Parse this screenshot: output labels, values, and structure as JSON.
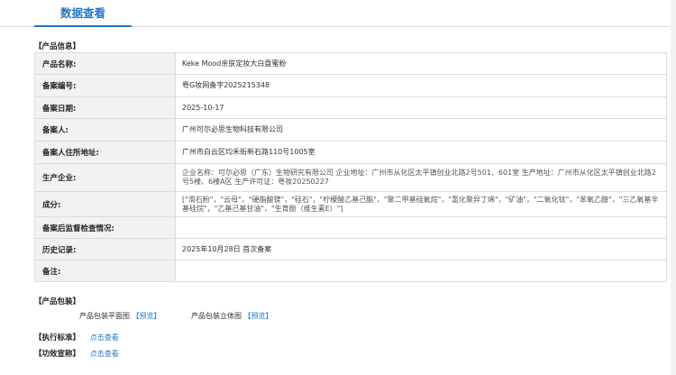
{
  "tabs": {
    "active": "数据查看"
  },
  "product_info": {
    "section_title": "【产品信息】",
    "rows": [
      {
        "label": "产品名称:",
        "value": "Keke Mood亲肤定妆大白盘蜜粉"
      },
      {
        "label": "备案编号:",
        "value": "粤G妆网备字2025215348"
      },
      {
        "label": "备案日期:",
        "value": "2025-10-17"
      },
      {
        "label": "备案人:",
        "value": "广州可尔必思生物科技有限公司"
      },
      {
        "label": "备案人住所地址:",
        "value": "广州市白云区均禾街新石路110号1005室"
      },
      {
        "label": "生产企业:",
        "value": "企业名称：可尔必思（广东）生物研究有限公司 企业地址：广州市从化区太平镇创业北路2号501、601室 生产地址：广州市从化区太平镇创业北路2号5楼、6楼A区 生产许可证：粤妆20250227"
      },
      {
        "label": "成分:",
        "value": "[\"滑石粉\"，\"云母\"，\"硬脂酸镁\"，\"硅石\"，\"柠檬酸乙基己酯\"，\"聚二甲基硅氧烷\"，\"氢化聚异丁烯\"，\"矿油\"，\"二氧化钛\"，\"苯氧乙醇\"，\"三乙氧基辛基硅烷\"，\"乙基己基甘油\"，\"生育酚（维生素E）\"]"
      },
      {
        "label": "备案后监督检查情况:",
        "value": ""
      },
      {
        "label": "历史记录:",
        "value": "2025年10月28日 首次备案"
      },
      {
        "label": "备注:",
        "value": ""
      }
    ]
  },
  "packaging": {
    "section_title": "【产品包装】",
    "flat_label": "产品包装平面图",
    "flat_link": "【预览】",
    "stereo_label": "产品包装立体图",
    "stereo_link": "【预览】"
  },
  "standard": {
    "title": "【执行标准】",
    "link": "点击查看"
  },
  "efficacy": {
    "title": "【功效宣称】",
    "link": "点击查看"
  },
  "colors": {
    "accent": "#1f77c9",
    "label_bg": "#f2f2f2",
    "border": "#dcdcdc"
  }
}
